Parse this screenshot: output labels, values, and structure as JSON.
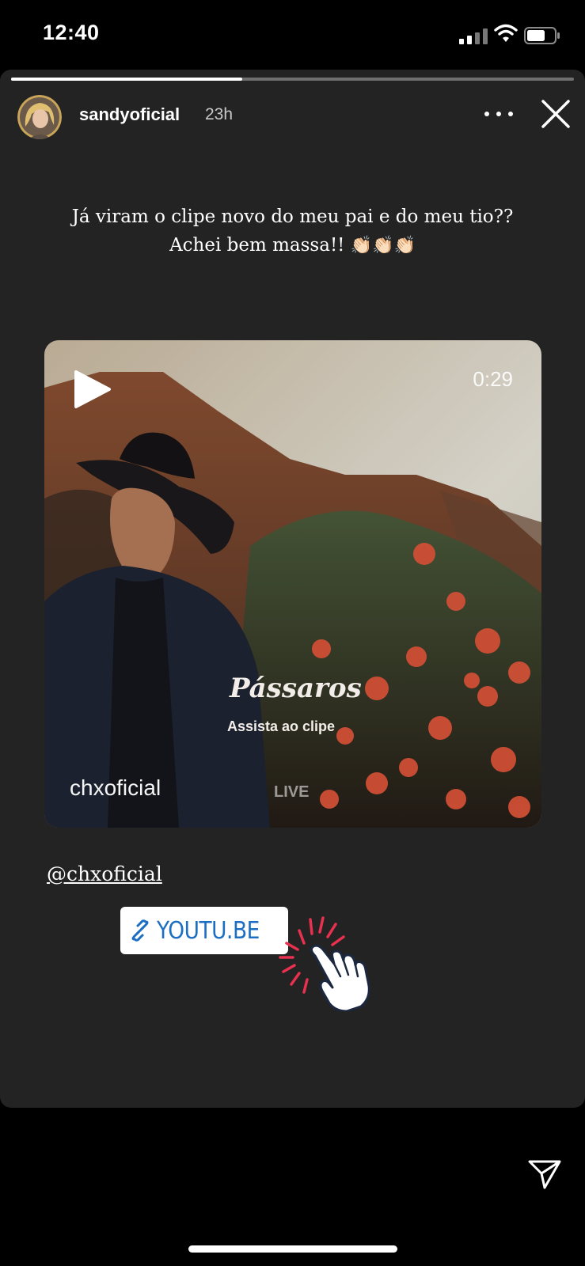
{
  "status_bar": {
    "time": "12:40",
    "icons": [
      "cellular-signal-icon",
      "wifi-icon",
      "battery-icon"
    ]
  },
  "story": {
    "progress": 0.41,
    "username": "sandyoficial",
    "time_ago": "23h",
    "caption_line1": "Já viram o clipe novo do meu pai e do meu tio??",
    "caption_line2": "Achei bem massa!!",
    "caption_emoji": "👏🏻👏🏻👏🏻"
  },
  "video": {
    "duration": "0:29",
    "title": "Pássaros",
    "subtitle": "Assista ao clipe",
    "account": "chxoficial",
    "watermark": "LIVE"
  },
  "mention": "@chxoficial",
  "link_sticker": {
    "label": "YOUTU.BE"
  },
  "colors": {
    "background": "#000000",
    "card": "#232323",
    "link_text": "#1b6ec2",
    "tap_burst": "#e8304f"
  }
}
